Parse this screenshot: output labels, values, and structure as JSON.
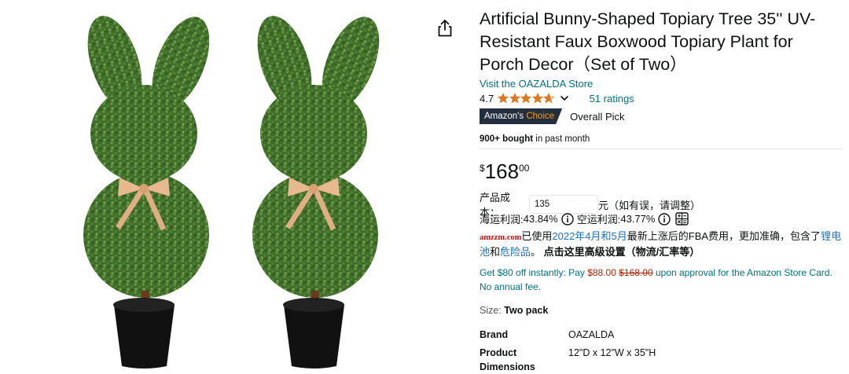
{
  "product": {
    "title": "Artificial Bunny-Shaped Topiary Tree 35'' UV-Resistant Faux Boxwood Topiary Plant for Porch Decor（Set of Two）",
    "store_link": "Visit the OAZALDA Store",
    "rating_value": "4.7",
    "rating_stars": 4.7,
    "ratings_count": "51 ratings",
    "badge_left": "Amazon's",
    "badge_right": "Choice",
    "badge_text": "Overall Pick",
    "bought_bold": "900+ bought",
    "bought_rest": " in past month",
    "price_symbol": "$",
    "price_whole": "168",
    "price_fraction": "00"
  },
  "plugin": {
    "cost_label": "产品成本：",
    "cost_value": "135",
    "cost_suffix": "元（如有误，请调整）",
    "sea_label": "海运利润: ",
    "sea_value": "43.84%",
    "air_label": "空运利润: ",
    "air_value": "43.77%",
    "logo": "amzzm.com",
    "note_1": "已使用",
    "note_2": "2022年4月和5月",
    "note_3": "最新上涨后的FBA费用，更加准确，包含了",
    "note_4": "锂电池",
    "note_5": "和",
    "note_6": "危险品",
    "note_7": "。",
    "note_8": " 点击这里高级设置（物流/汇率等）"
  },
  "card_offer": {
    "part1": "Get $80 off instantly: Pay ",
    "pay_price": "$88.00",
    "old_price": "$168.00",
    "part2": " upon approval for the Amazon Store Card. No annual fee."
  },
  "size": {
    "label": "Size: ",
    "value": "Two pack"
  },
  "specs": [
    {
      "key": "Brand",
      "value": "OAZALDA"
    },
    {
      "key": "Product Dimensions",
      "value": "12\"D x 12\"W x 35\"H"
    }
  ],
  "colors": {
    "link": "#007185",
    "star": "#de7921",
    "price_red": "#b12704",
    "badge_bg": "#232f3e",
    "badge_orange": "#ff9900"
  },
  "icons": [
    "share-icon",
    "star-icon",
    "chevron-down-icon",
    "info-icon",
    "calculator-icon"
  ]
}
